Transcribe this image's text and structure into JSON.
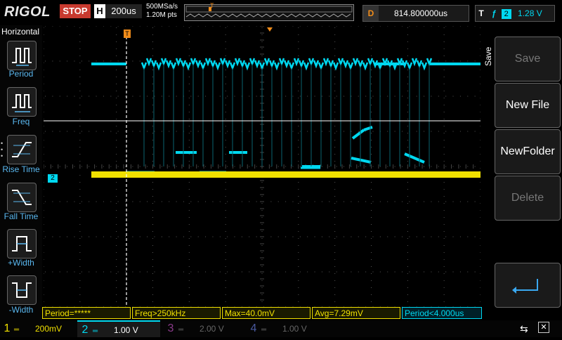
{
  "header": {
    "logo": "RIGOL",
    "run_state": "STOP",
    "timebase_key": "H",
    "timebase_value": "200us",
    "sample_rate": "500MSa/s",
    "memory_depth": "1.20M pts",
    "delay_key": "D",
    "delay_value": "814.800000us",
    "trigger_key": "T",
    "trigger_channel": "2",
    "trigger_level": "1.28 V"
  },
  "sidebar": {
    "title": "Horizontal",
    "items": [
      {
        "label": "Period",
        "icon": "period-icon"
      },
      {
        "label": "Freq",
        "icon": "freq-icon"
      },
      {
        "label": "Rise Time",
        "icon": "rise-time-icon"
      },
      {
        "label": "Fall Time",
        "icon": "fall-time-icon"
      },
      {
        "label": "+Width",
        "icon": "pos-width-icon"
      },
      {
        "label": "-Width",
        "icon": "neg-width-icon"
      }
    ]
  },
  "right_menu": {
    "tab": "Save",
    "buttons": [
      {
        "label": "Save",
        "enabled": false
      },
      {
        "label": "New File",
        "enabled": true
      },
      {
        "label": "NewFolder",
        "enabled": true
      },
      {
        "label": "Delete",
        "enabled": false
      }
    ]
  },
  "measurements": [
    {
      "text": "Period=*****"
    },
    {
      "text": "Freq>250kHz"
    },
    {
      "text": "Max=40.0mV"
    },
    {
      "text": "Avg=7.29mV"
    },
    {
      "text": "Period<4.000us"
    }
  ],
  "channels": [
    {
      "num": "1",
      "scale": "200mV",
      "color": "#f0e000"
    },
    {
      "num": "2",
      "scale": "1.00 V",
      "color": "#00e0f0"
    },
    {
      "num": "3",
      "scale": "2.00 V",
      "color": "#8a3a8a"
    },
    {
      "num": "4",
      "scale": "1.00 V",
      "color": "#3a4a8a"
    }
  ],
  "markers": {
    "ch2_ground": "2",
    "trigger_marker": "T"
  },
  "colors": {
    "ch1": "#f0e000",
    "ch2": "#00d8f0",
    "accent_orange": "#f08c1a",
    "stop_red": "#c83a2f"
  }
}
